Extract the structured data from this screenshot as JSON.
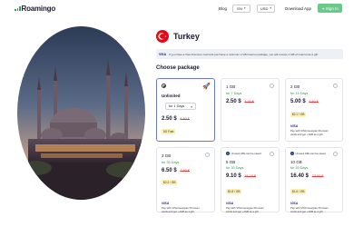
{
  "header": {
    "logo_text": "Roamingo",
    "blog": "Blog",
    "lang": "EN",
    "currency": "USD",
    "download": "Download App",
    "signin": "Sign In"
  },
  "country": {
    "name": "Turkey",
    "flag_color": "#e30a17"
  },
  "notice": {
    "badge": "VISA",
    "text": "If you have a Visa Premium card and purchase a minimum 2 GB Internet package, you will receive 1 GB of internet as a gift."
  },
  "choose_label": "Choose package",
  "packages": [
    {
      "title": "Unlimited",
      "days_select": "for 1 Days",
      "price": "2.50 $",
      "old_price": "4.80 $",
      "badge": "5G Fast",
      "selected": true
    },
    {
      "title": "1 GB",
      "days": "for 7 Days",
      "price": "2.50 $",
      "old_price": "4.20 $"
    },
    {
      "title": "2 GB",
      "days": "for 15 Days",
      "price": "5.00 $",
      "old_price": "5.80 $",
      "badge": "$2.1 / GB",
      "visa_text": "Pay with VISA Georgian Premium cards and get +1GB as a gift"
    },
    {
      "title": "3 GB",
      "days": "for 30 Days",
      "price": "6.50 $",
      "old_price": "7.80 $",
      "badge": "$2.2 / GB",
      "visa_text": "Pay with VISA Georgian Premium cards and get +1GB as a gift"
    },
    {
      "tag": "Unused GBs can be saved",
      "title": "5 GB",
      "days": "for 30 Days",
      "price": "9.10 $",
      "old_price": "16.20 $",
      "badge": "$1.8 / GB",
      "visa_text": "Pay with VISA Georgian Premium cards and get +1GB as a gift"
    },
    {
      "tag": "Unused GBs can be saved",
      "title": "10 GB",
      "days": "for 30 Days",
      "price": "16.40 $",
      "old_price": "27.00 $",
      "badge": "$1.6 / GB",
      "visa_text": "Pay with VISA Georgian Premium cards and get +1GB as a gift"
    }
  ],
  "visa_logo": "VISA",
  "icons": {
    "rocket": "rocket-icon",
    "lang_chevron": "chevron-down-icon",
    "signin": "login-icon"
  },
  "colors": {
    "accent_green": "#2aa84a",
    "signin_bg": "#6ac88a",
    "selected_border": "#6b79c9",
    "old_price": "#e23b3b"
  }
}
